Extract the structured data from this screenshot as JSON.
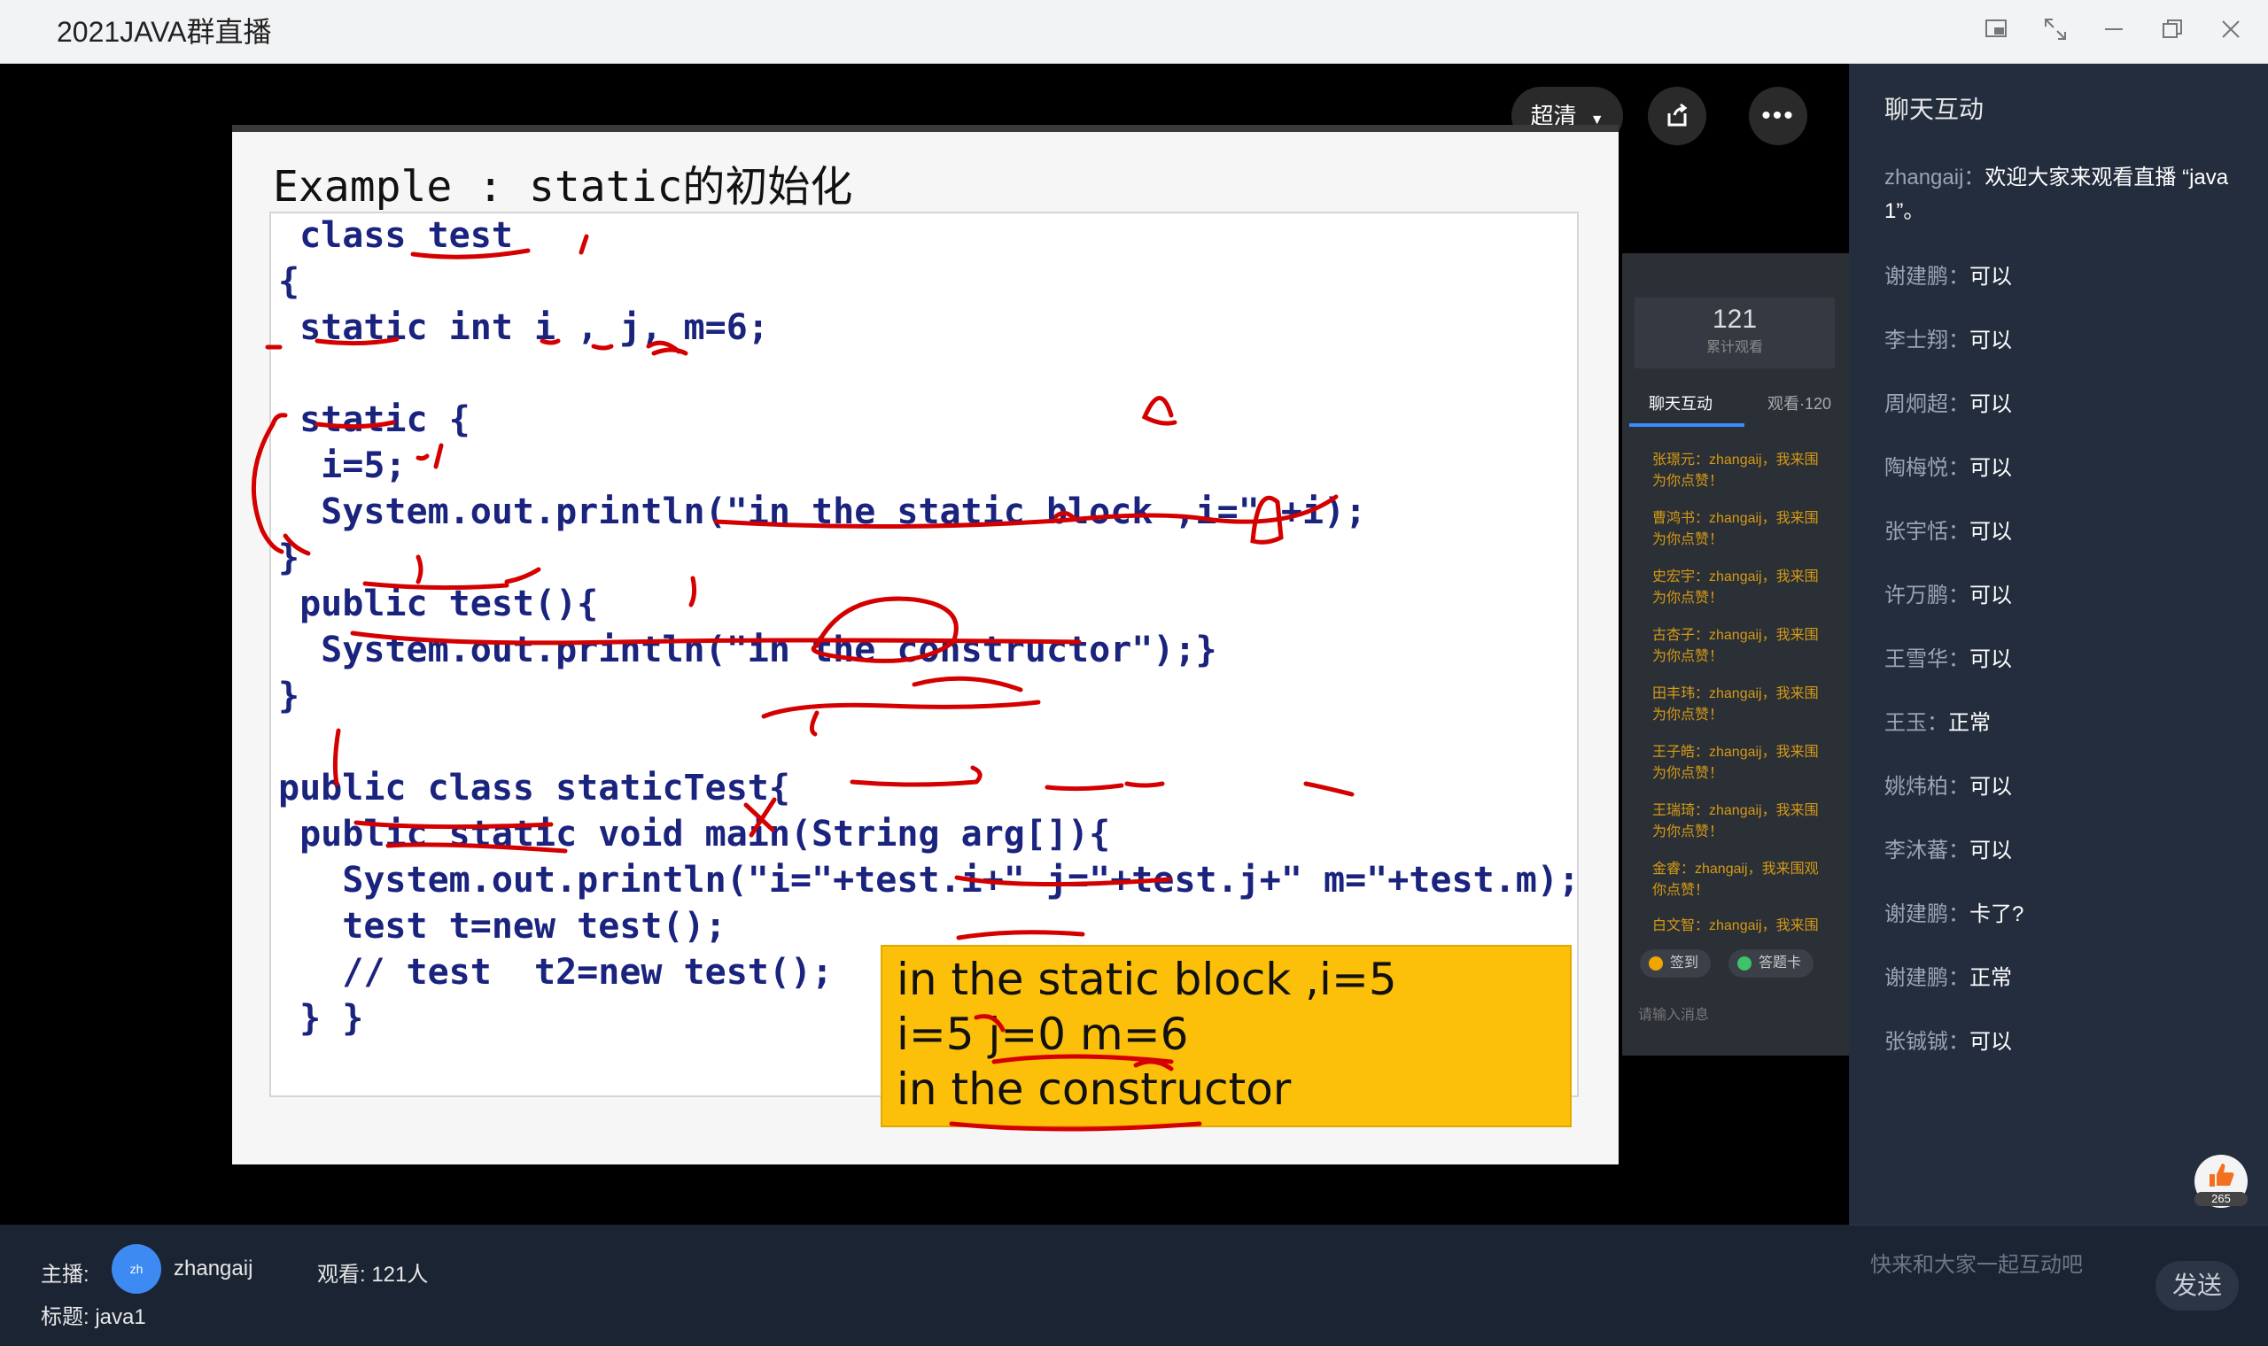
{
  "window": {
    "title": "2021JAVA群直播",
    "buttons": [
      "picture-in-picture",
      "fullscreen",
      "minimize",
      "restore",
      "close"
    ]
  },
  "player": {
    "quality_label": "超清",
    "share_icon": "share-icon",
    "more_icon": "more-icon"
  },
  "slide": {
    "heading": "Example : static的初始化",
    "code": [
      " class test",
      "{",
      " static int i , j, m=6;",
      "",
      " static {",
      "  i=5;",
      "  System.out.println(\"in the static block ,i=\" +i);",
      "}",
      " public test(){",
      "  System.out.println(\"in the constructor\");}",
      "}",
      "",
      "public class staticTest{",
      " public static void main(String arg[]){",
      "   System.out.println(\"i=\"+test.i+\" j=\"+test.j+\" m=\"+test.m);",
      "   test t=new test();",
      "   // test  t2=new test();",
      " } }"
    ],
    "output": [
      "in the static block ,i=5",
      "i=5 j=0 m=6",
      "in the constructor"
    ]
  },
  "recorded_panel": {
    "count": "121",
    "count_label": "累计观看",
    "tabs": [
      "聊天互动",
      "观看·120"
    ],
    "messages": [
      "张璟元：zhangaij，我来围\n为你点赞！",
      "曹鸿书：zhangaij，我来围\n为你点赞！",
      "史宏宇：zhangaij，我来围\n为你点赞！",
      "古杏子：zhangaij，我来围\n为你点赞！",
      "田丰玮：zhangaij，我来围\n为你点赞！",
      "王子皓：zhangaij，我来围\n为你点赞！",
      "王瑞琦：zhangaij，我来围\n为你点赞！",
      "金睿：zhangaij，我来围观\n你点赞！",
      "白文智：zhangaij，我来围"
    ],
    "buttons": [
      "签到",
      "答题卡"
    ],
    "input_placeholder": "请输入消息"
  },
  "chat": {
    "title": "聊天互动",
    "messages": [
      {
        "user": "zhangaij：",
        "text": "欢迎大家来观看直播 “java 1”。"
      },
      {
        "user": "谢建鹏：",
        "text": "可以"
      },
      {
        "user": "李士翔：",
        "text": "可以"
      },
      {
        "user": "周炯超：",
        "text": "可以"
      },
      {
        "user": "陶梅悦：",
        "text": "可以"
      },
      {
        "user": "张宇恬：",
        "text": "可以"
      },
      {
        "user": "许万鹏：",
        "text": "可以"
      },
      {
        "user": "王雪华：",
        "text": "可以"
      },
      {
        "user": "王玉：",
        "text": "正常"
      },
      {
        "user": "姚炜柏：",
        "text": "可以"
      },
      {
        "user": "李沐蕃：",
        "text": "可以"
      },
      {
        "user": "谢建鹏：",
        "text": "卡了?"
      },
      {
        "user": "谢建鹏：",
        "text": "正常"
      },
      {
        "user": "张铖铖：",
        "text": "可以"
      }
    ],
    "like_count": "265",
    "input_placeholder": "快来和大家一起互动吧",
    "send_label": "发送"
  },
  "info": {
    "host_label": "主播:",
    "host_avatar_text": "zh",
    "host_name": "zhangaij",
    "viewers_label": "观看: 121人",
    "topic_label": "标题: java1"
  }
}
